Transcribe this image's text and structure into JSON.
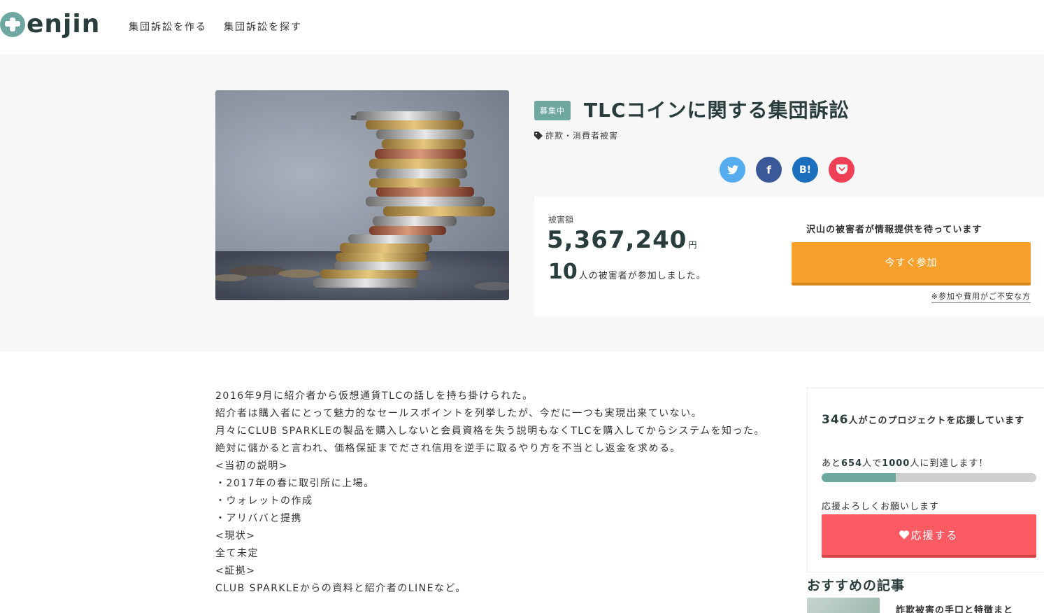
{
  "header": {
    "logo_text": "enjin",
    "nav": [
      "集団訴訟を作る",
      "集団訴訟を探す"
    ]
  },
  "project": {
    "status_badge": "募集中",
    "title": "TLCコインに関する集団訴訟",
    "tags": "詐欺・消費者被害",
    "share_buttons": [
      {
        "name": "twitter-icon",
        "label": ""
      },
      {
        "name": "facebook-icon",
        "label": "f"
      },
      {
        "name": "hatena-bookmark-icon",
        "label": "B!"
      },
      {
        "name": "pocket-icon",
        "label": ""
      }
    ],
    "damage_label": "被害額",
    "damage_amount": "5,367,240",
    "damage_unit": "円",
    "victim_count": "10",
    "victim_text": "人の被害者が参加しました。",
    "waiting_text": "沢山の被害者が情報提供を待っています",
    "join_label": "今すぐ参加",
    "fee_link": "※参加や費用がご不安な方"
  },
  "story": [
    "2016年9月に紹介者から仮想通貨TLCの話しを持ち掛けられた。",
    "紹介者は購入者にとって魅力的なセールスポイントを列挙したが、今だに一つも実現出来ていない。",
    "月々にCLUB SPARKLEの製品を購入しないと会員資格を失う説明もなくTLCを購入してからシステムを知った。",
    "絶対に儲かると言われ、価格保証までだされ信用を逆手に取るやり方を不当とし返金を求める。",
    "<当初の説明>",
    "・2017年の春に取引所に上場。",
    "・ウォレットの作成",
    "・アリババと提携",
    "<現状>",
    "全て未定",
    "<証拠>",
    "CLUB SPARKLEからの資料と紹介者のLINEなど。"
  ],
  "support": {
    "count": "346",
    "count_text": "人がこのプロジェクトを応援しています",
    "remain_prefix": "あと",
    "remain_count": "654",
    "remain_mid": "人で",
    "goal_count": "1000",
    "remain_suffix": "人に到達します！",
    "progress_fraction": 0.346,
    "ask_text": "応援よろしくお願いします",
    "button_label": "応援する"
  },
  "recommend": {
    "title": "おすすめの記事",
    "items": [
      "詐欺被害の手口と特徴まと"
    ]
  },
  "colors": {
    "accent": "#6fa8a0",
    "join": "#f7a12c",
    "support": "#fd5b63"
  }
}
